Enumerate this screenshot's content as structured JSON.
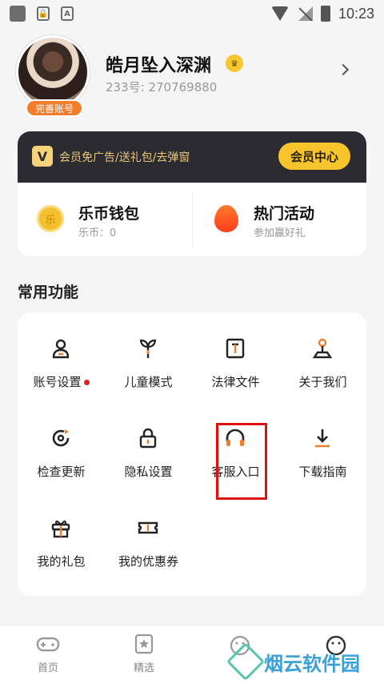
{
  "status_bar": {
    "time": "10:23"
  },
  "profile": {
    "name": "皓月坠入深渊",
    "uid": "233号: 270769880",
    "badge": "完善账号"
  },
  "vip": {
    "logo": "V",
    "text": "会员免广告/送礼包/去弹窗",
    "button": "会员中心"
  },
  "wallet": {
    "coin_title": "乐币钱包",
    "coin_sub": "乐币：0",
    "coin_icon_text": "乐",
    "activity_title": "热门活动",
    "activity_sub": "参加赢好礼"
  },
  "section_title": "常用功能",
  "functions": [
    {
      "label": "账号设置",
      "icon": "user-icon",
      "dot": true
    },
    {
      "label": "儿童模式",
      "icon": "sprout-icon"
    },
    {
      "label": "法律文件",
      "icon": "document-icon"
    },
    {
      "label": "关于我们",
      "icon": "joystick-icon"
    },
    {
      "label": "检查更新",
      "icon": "refresh-icon"
    },
    {
      "label": "隐私设置",
      "icon": "lock-icon"
    },
    {
      "label": "客服入口",
      "icon": "headset-icon"
    },
    {
      "label": "下载指南",
      "icon": "download-icon"
    },
    {
      "label": "我的礼包",
      "icon": "gift-icon"
    },
    {
      "label": "我的优惠券",
      "icon": "coupon-icon"
    }
  ],
  "bottom_nav": [
    {
      "label": "首页",
      "icon": "gamepad-icon"
    },
    {
      "label": "精选",
      "icon": "star-icon"
    },
    {
      "label": "",
      "icon": "smile-icon"
    },
    {
      "label": "",
      "icon": "profile-icon"
    }
  ],
  "watermark": "烟云软件园",
  "colors": {
    "accent": "#f7c52b",
    "orange": "#f27d2c",
    "vip_bg": "#2b2b31",
    "highlight": "#e01010"
  }
}
